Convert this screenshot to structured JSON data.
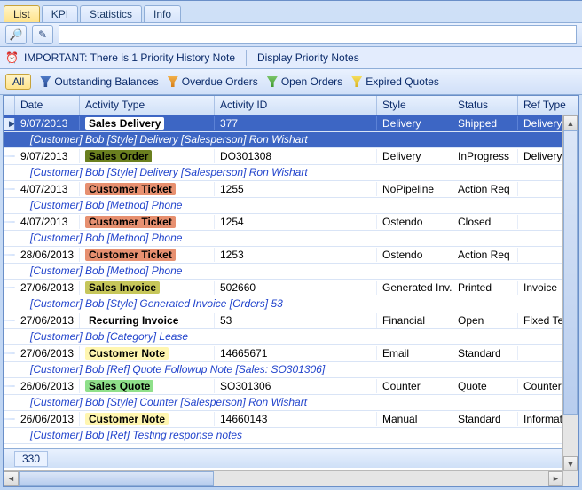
{
  "tabs": [
    {
      "label": "List",
      "active": true
    },
    {
      "label": "KPI"
    },
    {
      "label": "Statistics"
    },
    {
      "label": "Info"
    }
  ],
  "toolbar": {
    "search_icon": "🔎",
    "eraser_icon": "✎",
    "search_value": ""
  },
  "alert": {
    "icon": "⏰",
    "text": "IMPORTANT: There is 1 Priority History Note",
    "link": "Display Priority Notes"
  },
  "filters": {
    "all": "All",
    "items": [
      {
        "label": "Outstanding Balances",
        "cls": "funnel"
      },
      {
        "label": "Overdue Orders",
        "cls": "funnel funnelO"
      },
      {
        "label": "Open Orders",
        "cls": "funnel funnelG"
      },
      {
        "label": "Expired Quotes",
        "cls": "funnel funnelY"
      }
    ]
  },
  "columns": {
    "date": "Date",
    "activity_type": "Activity Type",
    "activity_id": "Activity ID",
    "style": "Style",
    "status": "Status",
    "ref_type": "Ref Type"
  },
  "rows": [
    {
      "selected": true,
      "date": "9/07/2013",
      "activity_type": "Sales Delivery",
      "act_bg": "#ffffff",
      "act_fg": "#000",
      "id": "377",
      "style": "Delivery",
      "status": "Shipped",
      "ref": "DeliveryOrder",
      "detail": "[Customer] Bob [Style] Delivery [Salesperson] Ron Wishart"
    },
    {
      "date": "9/07/2013",
      "activity_type": "Sales Order",
      "act_bg": "#6a7f1f",
      "act_fg": "#000",
      "id": "DO301308",
      "style": "Delivery",
      "status": "InProgress",
      "ref": "DeliveryOrder",
      "detail": "[Customer] Bob [Style] Delivery [Salesperson] Ron Wishart"
    },
    {
      "date": "4/07/2013",
      "activity_type": "Customer Ticket",
      "act_bg": "#e79070",
      "act_fg": "#000",
      "id": "1255",
      "style": "NoPipeline",
      "status": "Action Req",
      "ref": "",
      "detail": "[Customer] Bob [Method] Phone"
    },
    {
      "date": "4/07/2013",
      "activity_type": "Customer Ticket",
      "act_bg": "#e79070",
      "act_fg": "#000",
      "id": "1254",
      "style": "Ostendo",
      "status": "Closed",
      "ref": "",
      "detail": "[Customer] Bob [Method] Phone"
    },
    {
      "date": "28/06/2013",
      "activity_type": "Customer Ticket",
      "act_bg": "#e79070",
      "act_fg": "#000",
      "id": "1253",
      "style": "Ostendo",
      "status": "Action Req",
      "ref": "",
      "detail": "[Customer] Bob [Method] Phone"
    },
    {
      "date": "27/06/2013",
      "activity_type": "Sales Invoice",
      "act_bg": "#c6c65a",
      "act_fg": "#000",
      "id": "502660",
      "style": "Generated Inv...",
      "status": "Printed",
      "ref": "Invoice",
      "detail": "[Customer] Bob [Style] Generated Invoice [Orders] 53"
    },
    {
      "date": "27/06/2013",
      "activity_type": "Recurring Invoice",
      "act_bg": "",
      "act_fg": "#000",
      "id": "53",
      "style": "Financial",
      "status": "Open",
      "ref": "Fixed Term",
      "detail": "[Customer] Bob [Category] Lease"
    },
    {
      "date": "27/06/2013",
      "activity_type": "Customer Note",
      "act_bg": "#fff6b0",
      "act_fg": "#000",
      "id": "14665671",
      "style": "Email",
      "status": "Standard",
      "ref": "",
      "detail": "[Customer] Bob [Ref] Quote Followup Note [Sales: SO301306]"
    },
    {
      "date": "26/06/2013",
      "activity_type": "Sales Quote",
      "act_bg": "#8fe08a",
      "act_fg": "#000",
      "id": "SO301306",
      "style": "Counter",
      "status": "Quote",
      "ref": "CounterSale",
      "detail": "[Customer] Bob [Style] Counter [Salesperson] Ron Wishart"
    },
    {
      "date": "26/06/2013",
      "activity_type": "Customer Note",
      "act_bg": "#fff6b0",
      "act_fg": "#000",
      "id": "14660143",
      "style": "Manual",
      "status": "Standard",
      "ref": "Information",
      "detail": "[Customer] Bob [Ref] Testing response notes"
    }
  ],
  "footer": {
    "count": "330"
  }
}
